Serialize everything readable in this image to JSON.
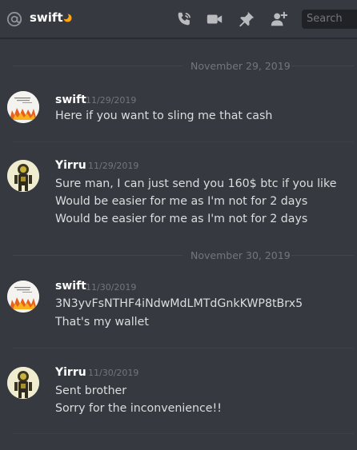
{
  "header": {
    "channel_name": "swift",
    "search_placeholder": "Search",
    "icons": [
      "at-icon",
      "moon-status-icon",
      "call-icon",
      "video-icon",
      "pin-icon",
      "add-member-icon"
    ]
  },
  "dividers": [
    {
      "date": "November 29, 2019"
    },
    {
      "date": "November 30, 2019"
    }
  ],
  "messages": [
    {
      "author": "swift",
      "timestamp": "11/29/2019",
      "lines": [
        "Here if you want to sling me that cash"
      ]
    },
    {
      "author": "Yirru",
      "timestamp": "11/29/2019",
      "lines": [
        "Sure man, I can just send you 160$ btc if you like",
        "Would be easier for me as I'm not for 2 days",
        "Would be easier for me as I'm not for 2 days"
      ]
    },
    {
      "author": "swift",
      "timestamp": "11/30/2019",
      "lines": [
        "3N3yvFsNTHF4iNdwMdLMTdGnkKWP8tBrx5",
        "That's my wallet"
      ]
    },
    {
      "author": "Yirru",
      "timestamp": "11/30/2019",
      "lines": [
        "Sent brother",
        "Sorry for the inconvenience!!"
      ]
    }
  ],
  "colors": {
    "background": "#36393f",
    "header_text": "#ffffff",
    "muted": "#72767d",
    "message_text": "#dcddde",
    "status_moon": "#faa61a"
  }
}
